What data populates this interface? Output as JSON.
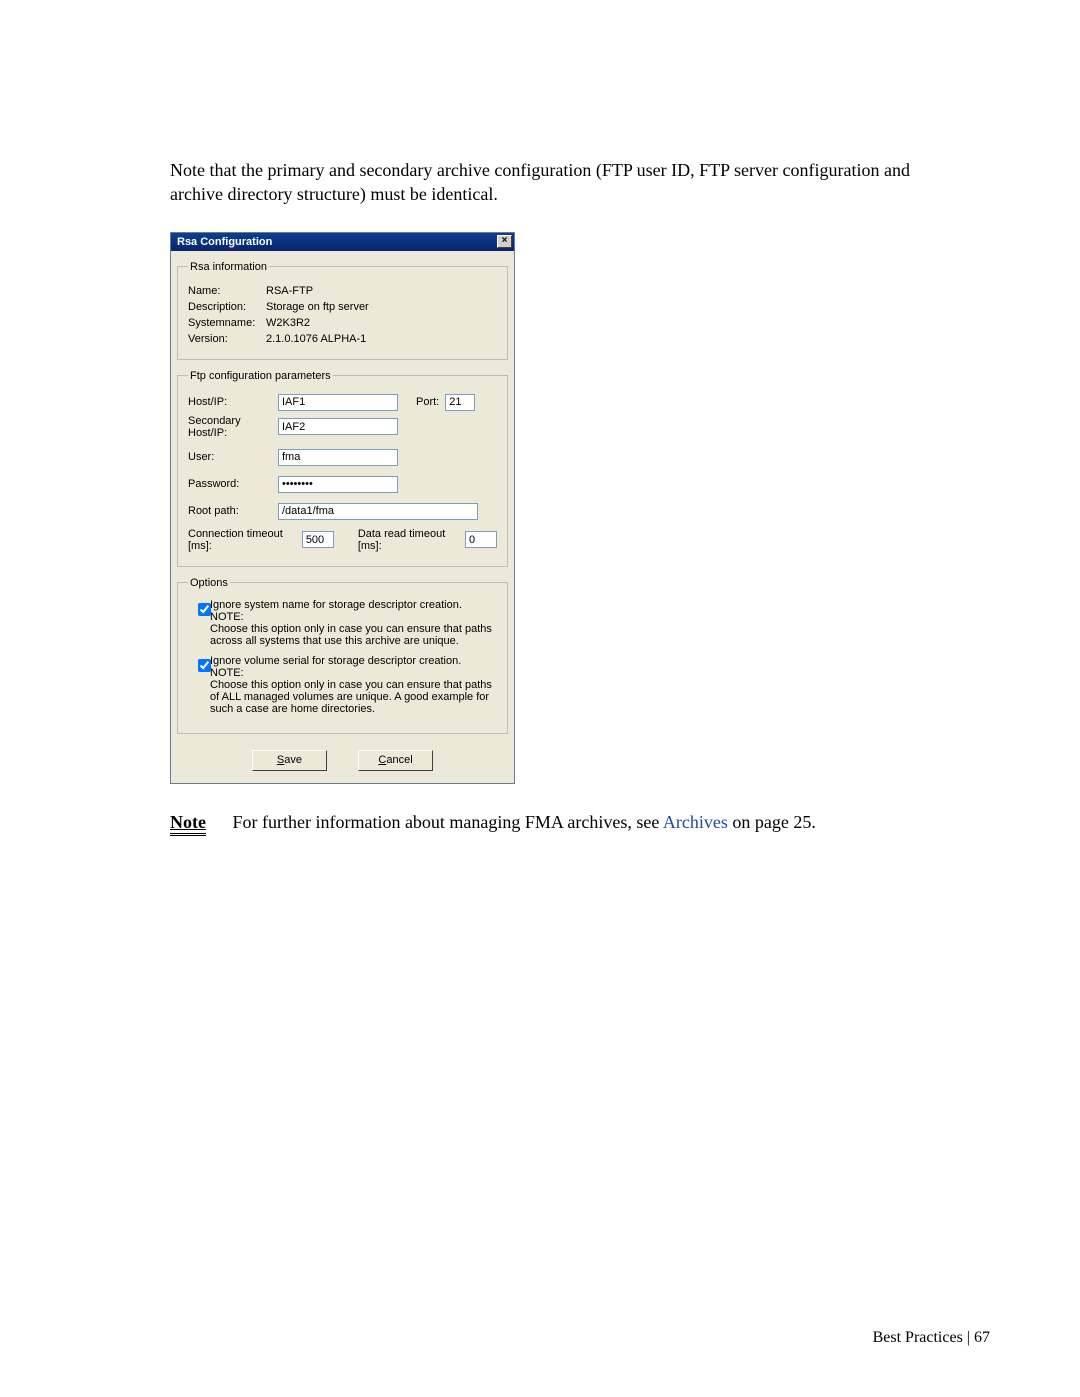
{
  "intro": "Note that the primary and secondary archive configuration (FTP user ID, FTP server configuration and archive directory structure) must be identical.",
  "dialog": {
    "title": "Rsa Configuration",
    "info": {
      "legend": "Rsa information",
      "name_label": "Name:",
      "name": "RSA-FTP",
      "desc_label": "Description:",
      "desc": "Storage on ftp server",
      "sysname_label": "Systemname:",
      "sysname": "W2K3R2",
      "version_label": "Version:",
      "version": "2.1.0.1076 ALPHA-1"
    },
    "ftp": {
      "legend": "Ftp configuration parameters",
      "host_label": "Host/IP:",
      "host": "IAF1",
      "port_label": "Port:",
      "port": "21",
      "sechost_label": "Secondary Host/IP:",
      "sechost": "IAF2",
      "user_label": "User:",
      "user": "fma",
      "pass_label": "Password:",
      "pass": "••••••••",
      "root_label": "Root path:",
      "root": "/data1/fma",
      "ct_label": "Connection timeout [ms]:",
      "ct": "500",
      "drt_label": "Data read timeout [ms]:",
      "drt": "0"
    },
    "options": {
      "legend": "Options",
      "opt1_label": "Ignore system name for storage descriptor creation.",
      "opt1_note_label": "NOTE:",
      "opt1_note": "Choose this option only in case you can ensure that paths across all systems that use this archive are unique.",
      "opt2_label": "Ignore volume serial for storage descriptor creation.",
      "opt2_note_label": "NOTE:",
      "opt2_note": "Choose this option only in case you can ensure that paths of ALL managed volumes are unique. A good example for such a case are home directories."
    },
    "buttons": {
      "save_prefix": "S",
      "save_rest": "ave",
      "cancel_prefix": "C",
      "cancel_rest": "ancel"
    }
  },
  "note": {
    "label": "Note",
    "text_before": "For further information about managing FMA archives, see ",
    "link": "Archives",
    "text_after": " on page 25."
  },
  "footer": {
    "section": "Best Practices",
    "sep": " | ",
    "page": "67"
  }
}
